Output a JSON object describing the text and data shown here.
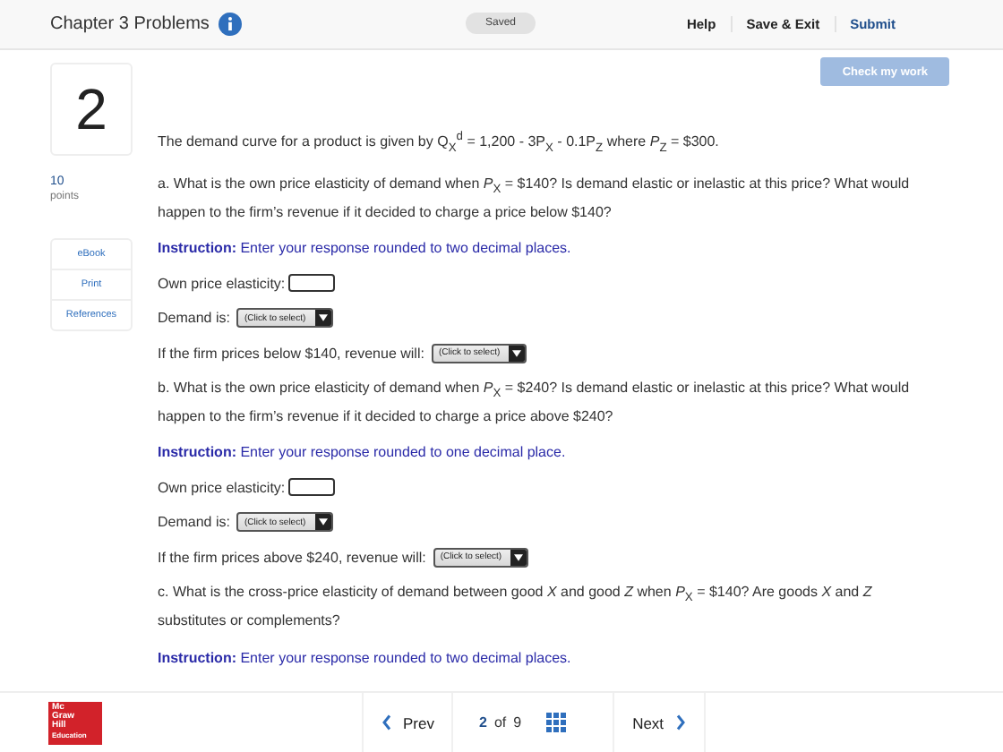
{
  "header": {
    "title": "Chapter 3 Problems",
    "status": "Saved",
    "links": [
      "Help",
      "Save & Exit",
      "Submit"
    ]
  },
  "question": {
    "number": "2",
    "points": "10",
    "points_label": "points",
    "check_button": {
      "label": "Check my work",
      "disabled": true
    },
    "resources": [
      "eBook",
      "Print",
      "References"
    ],
    "items": [
      {
        "kind": "paragraph",
        "text": "The demand curve for a product is given by Q$_{X}$$^{d}$ = 1,200 - 3P$_{X}$ - 0.1P$_{Z}$ where *P*$_{Z}$ = $300."
      },
      {
        "kind": "paragraph",
        "text": "a. What is the own price elasticity of demand when *P*$_{X}$ = $140? Is demand elastic or inelastic at this price? What would happen to the firm’s revenue if it decided to charge a price below $140?"
      },
      {
        "kind": "instruction",
        "text": "**Instruction:** Enter your response rounded to two decimal places."
      },
      {
        "kind": "input",
        "label": "Own price elasticity:"
      },
      {
        "kind": "select",
        "label": "Demand is:",
        "value": "(Click to select)"
      },
      {
        "kind": "select",
        "label": "If the firm prices below $140, revenue will:",
        "value": "(Click to select)"
      },
      {
        "kind": "paragraph",
        "text": "b. What is the own price elasticity of demand when *P*$_{X}$ = $240? Is demand elastic or inelastic at this price? What would happen to the firm’s revenue if it decided to charge a price above $240?"
      },
      {
        "kind": "instruction",
        "text": "**Instruction:** Enter your response rounded to one decimal place."
      },
      {
        "kind": "input",
        "label": "Own price elasticity:"
      },
      {
        "kind": "select",
        "label": "Demand is:",
        "value": "(Click to select)"
      },
      {
        "kind": "select",
        "label": "If the firm prices above $240, revenue will:",
        "value": "(Click to select)"
      },
      {
        "kind": "paragraph",
        "text": "c. What is the cross-price elasticity of demand between good *X* and good *Z* when *P*$_{X}$ = $140? Are goods *X* and *Z* substitutes or complements?"
      },
      {
        "kind": "instruction",
        "text": "**Instruction:** Enter your response rounded to two decimal places."
      }
    ]
  },
  "footer": {
    "logo": [
      "Mc",
      "Graw",
      "Hill",
      "Education"
    ],
    "prev": "Prev",
    "page": "2",
    "of": "of",
    "total": "9",
    "next": "Next"
  }
}
